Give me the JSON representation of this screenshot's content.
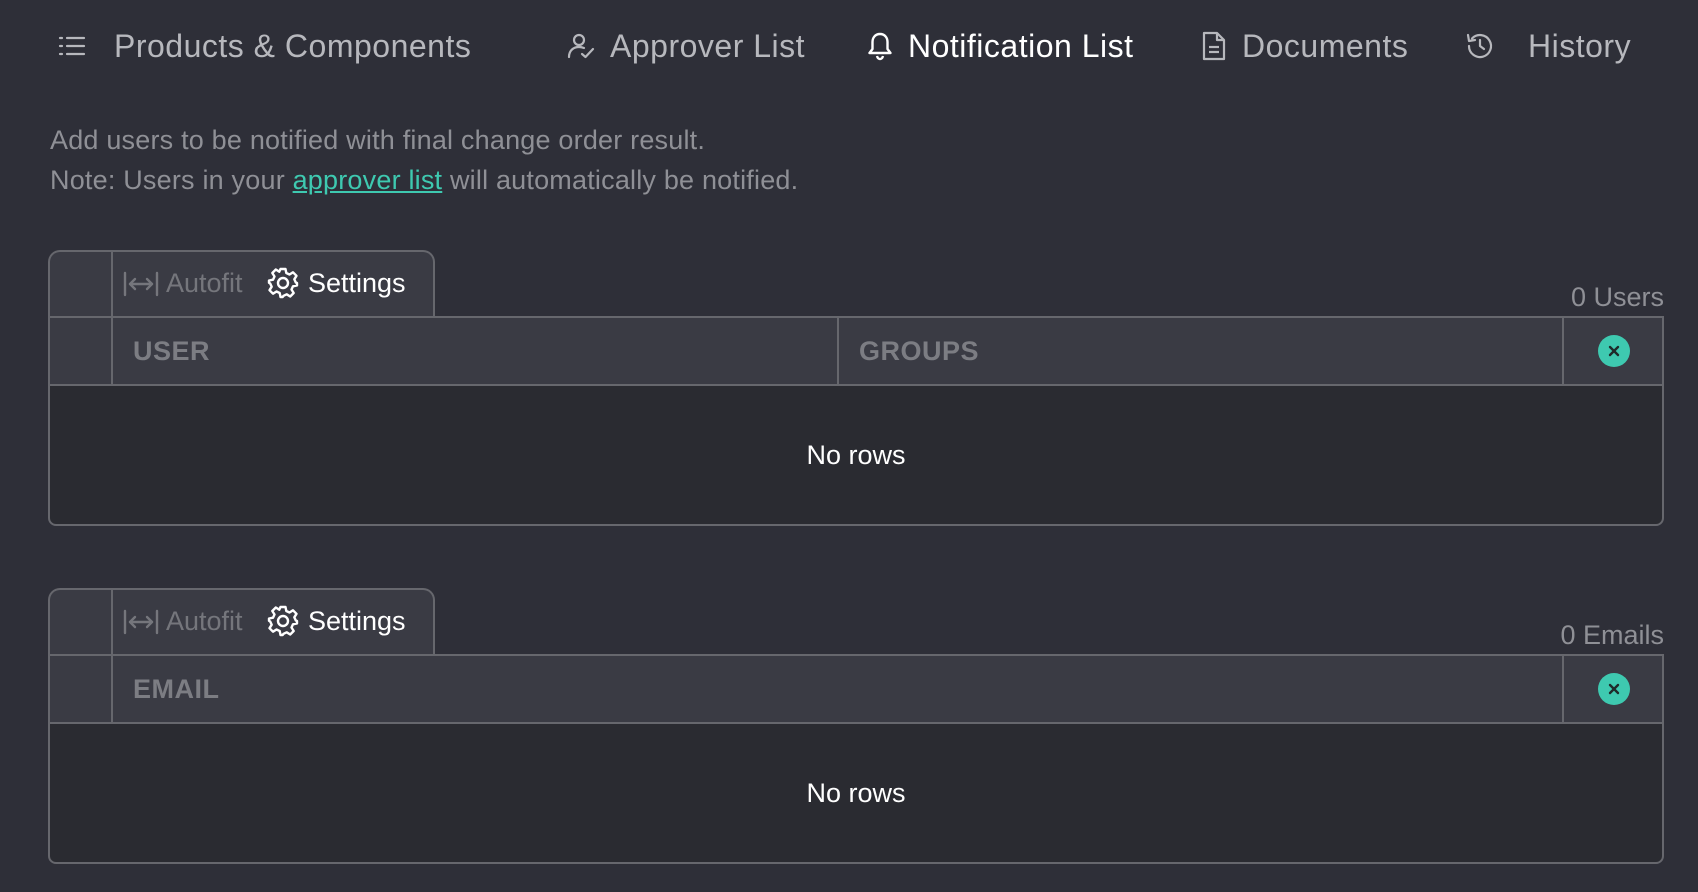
{
  "tabs": [
    {
      "label": "Products & Components",
      "icon": "list-icon"
    },
    {
      "label": "Approver List",
      "icon": "user-check-icon"
    },
    {
      "label": "Notification List",
      "icon": "bell-icon",
      "active": true
    },
    {
      "label": "Documents",
      "icon": "document-icon"
    },
    {
      "label": "History",
      "icon": "history-icon"
    }
  ],
  "description": {
    "line1": "Add users to be notified with final change order result.",
    "line2_prefix": "Note: Users in your ",
    "line2_link": "approver list",
    "line2_suffix": " will automatically be notified."
  },
  "users_table": {
    "autofit_label": "Autofit",
    "settings_label": "Settings",
    "count": "0 Users",
    "columns": [
      "USER",
      "GROUPS"
    ],
    "empty_text": "No rows"
  },
  "emails_table": {
    "autofit_label": "Autofit",
    "settings_label": "Settings",
    "count": "0 Emails",
    "columns": [
      "EMAIL"
    ],
    "empty_text": "No rows"
  },
  "colors": {
    "background": "#2e2f38",
    "accent": "#3ec9b0",
    "border": "#66676d"
  }
}
